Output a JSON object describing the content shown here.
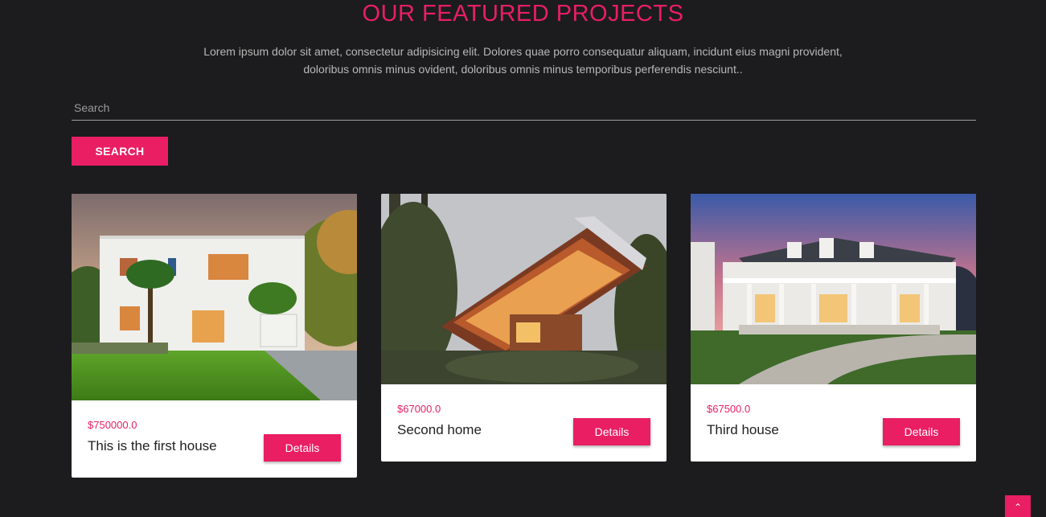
{
  "header": {
    "title": "OUR FEATURED PROJECTS",
    "subtitle_line1": "Lorem ipsum dolor sit amet, consectetur adipisicing elit. Dolores quae porro consequatur aliquam, incidunt eius magni provident,",
    "subtitle_line2": "doloribus omnis minus ovident, doloribus omnis minus temporibus perferendis nesciunt.."
  },
  "search": {
    "placeholder": "Search",
    "button_label": "SEARCH"
  },
  "projects": [
    {
      "price": "$750000.0",
      "name": "This is the first house",
      "button_label": "Details",
      "image": "modern-white-house-photo"
    },
    {
      "price": "$67000.0",
      "name": "Second home",
      "button_label": "Details",
      "image": "cantilevered-wood-house-photo"
    },
    {
      "price": "$67500.0",
      "name": "Third house",
      "button_label": "Details",
      "image": "colonial-mansion-photo"
    }
  ],
  "back_to_top": {
    "icon": "chevron-up-icon",
    "glyph": "⌃"
  },
  "colors": {
    "accent": "#e91e63",
    "background": "#1c1c1e",
    "card": "#ffffff"
  }
}
